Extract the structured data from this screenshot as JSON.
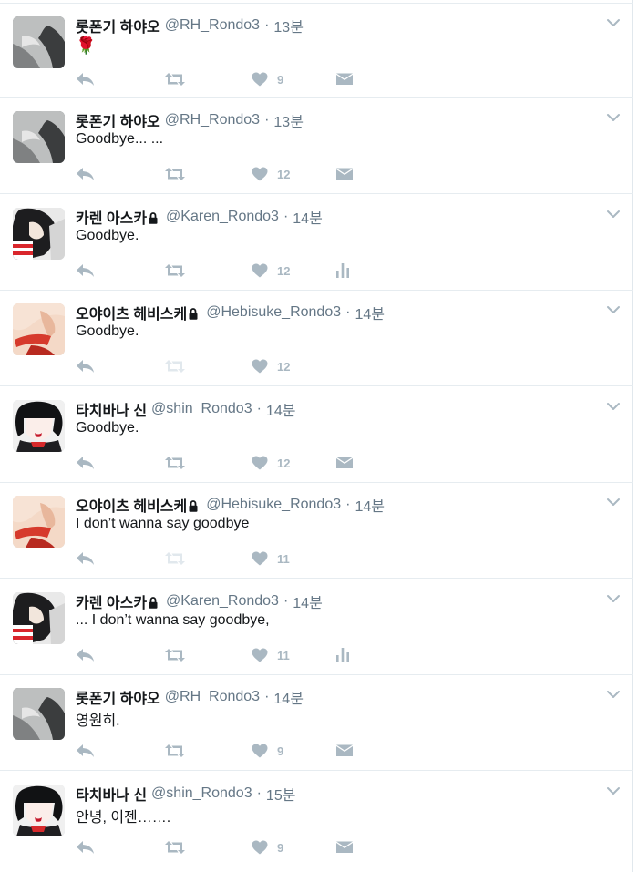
{
  "tweets": [
    {
      "name": "롯폰기 하야오",
      "handle": "@RH_Rondo3",
      "time": "13분",
      "text": "🌹",
      "likes": "9",
      "locked": false,
      "avatar": "gray",
      "retweet_enabled": true,
      "last_action": "dm",
      "rose": true
    },
    {
      "name": "롯폰기 하야오",
      "handle": "@RH_Rondo3",
      "time": "13분",
      "text": "Goodbye... ...",
      "likes": "12",
      "locked": false,
      "avatar": "gray",
      "retweet_enabled": true,
      "last_action": "dm"
    },
    {
      "name": "카렌 아스카",
      "handle": "@Karen_Rondo3",
      "time": "14분",
      "text": "Goodbye.",
      "likes": "12",
      "locked": true,
      "avatar": "karen",
      "retweet_enabled": true,
      "last_action": "analytics"
    },
    {
      "name": "오야이츠 헤비스케",
      "handle": "@Hebisuke_Rondo3",
      "time": "14분",
      "text": "Goodbye.",
      "likes": "12",
      "locked": true,
      "avatar": "hebisuke",
      "retweet_enabled": false,
      "last_action": "none"
    },
    {
      "name": "타치바나 신",
      "handle": "@shin_Rondo3",
      "time": "14분",
      "text": "Goodbye.",
      "likes": "12",
      "locked": false,
      "avatar": "shin",
      "retweet_enabled": true,
      "last_action": "dm"
    },
    {
      "name": "오야이츠 헤비스케",
      "handle": "@Hebisuke_Rondo3",
      "time": "14분",
      "text": "I don’t wanna say goodbye",
      "likes": "11",
      "locked": true,
      "avatar": "hebisuke",
      "retweet_enabled": false,
      "last_action": "none"
    },
    {
      "name": "카렌 아스카",
      "handle": "@Karen_Rondo3",
      "time": "14분",
      "text": "... I don’t wanna say goodbye,",
      "likes": "11",
      "locked": true,
      "avatar": "karen",
      "retweet_enabled": true,
      "last_action": "analytics"
    },
    {
      "name": "롯폰기 하야오",
      "handle": "@RH_Rondo3",
      "time": "14분",
      "text": "영원히.",
      "likes": "9",
      "locked": false,
      "avatar": "gray",
      "retweet_enabled": true,
      "last_action": "dm"
    },
    {
      "name": "타치바나 신",
      "handle": "@shin_Rondo3",
      "time": "15분",
      "text": "안녕, 이젠…….",
      "likes": "9",
      "locked": false,
      "avatar": "shin",
      "retweet_enabled": true,
      "last_action": "dm"
    }
  ],
  "colors": {
    "icon": "#aab8c2",
    "icon_disabled": "#e1e8ed",
    "secondary_text": "#657786",
    "divider": "#e6ecf0"
  }
}
